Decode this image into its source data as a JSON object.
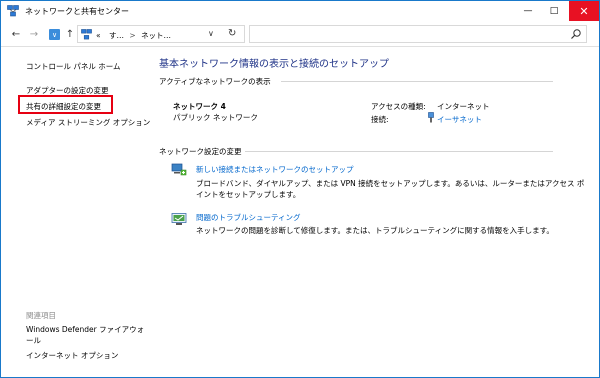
{
  "window": {
    "title": "ネットワークと共有センター",
    "minimize_glyph": "—",
    "maximize_glyph": "□",
    "close_glyph": "✕"
  },
  "nav": {
    "back_glyph": "←",
    "forward_glyph": "→",
    "recent_glyph": "∨",
    "up_glyph": "↑",
    "address": {
      "prefix": "«",
      "segment1": "す…",
      "separator": ">",
      "segment2": "ネット…",
      "dropdown_glyph": "∨",
      "refresh_glyph": "↻"
    },
    "search_placeholder": ""
  },
  "sidebar": {
    "home": "コントロール パネル ホーム",
    "items": [
      "アダプターの設定の変更",
      "共有の詳細設定の変更",
      "メディア ストリーミング オプション"
    ],
    "see_also_label": "関連項目",
    "see_also": [
      "Windows Defender ファイアウォール",
      "インターネット オプション"
    ]
  },
  "main": {
    "title": "基本ネットワーク情報の表示と接続のセットアップ",
    "active_networks_heading": "アクティブなネットワークの表示",
    "network": {
      "name": "ネットワーク 4",
      "type": "パブリック ネットワーク",
      "access_type_label": "アクセスの種類:",
      "access_type_value": "インターネット",
      "connection_label": "接続:",
      "connection_value": "イーサネット"
    },
    "change_settings_heading": "ネットワーク設定の変更",
    "tasks": [
      {
        "link": "新しい接続またはネットワークのセットアップ",
        "description": "ブロードバンド、ダイヤルアップ、または VPN 接続をセットアップします。あるいは、ルーターまたはアクセス ポイントをセットアップします。"
      },
      {
        "link": "問題のトラブルシューティング",
        "description": "ネットワークの問題を診断して修復します。または、トラブルシューティングに関する情報を入手します。"
      }
    ]
  },
  "colors": {
    "title_blue": "#1e3287",
    "link_blue": "#0066cc",
    "highlight_red": "#e60012",
    "close_red": "#e81123"
  }
}
